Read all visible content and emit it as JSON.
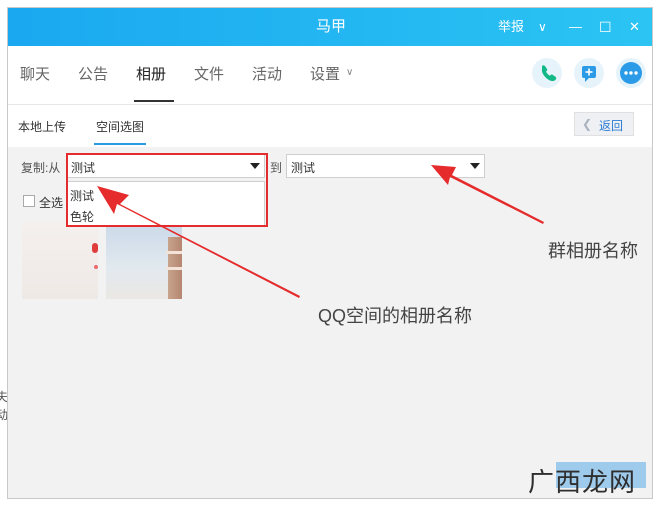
{
  "window": {
    "title": "马甲",
    "report_label": "举报",
    "chevron_glyph": "∨",
    "minimize_glyph": "—",
    "maximize_glyph": "☐",
    "close_glyph": "✕"
  },
  "tabs": [
    {
      "label": "聊天"
    },
    {
      "label": "公告"
    },
    {
      "label": "相册"
    },
    {
      "label": "文件"
    },
    {
      "label": "活动"
    },
    {
      "label": "设置"
    }
  ],
  "settings_chevron": "∨",
  "subtabs": {
    "local_upload": "本地上传",
    "space_select": "空间选图"
  },
  "back_button": {
    "label": "返回",
    "glyph": "❮"
  },
  "copy_row": {
    "from_label": "复制:从",
    "from_value": "测试",
    "to_label": "到",
    "to_value": "测试"
  },
  "dropdown_options": [
    "测试",
    "色轮"
  ],
  "select_all_label": "全选",
  "annotations": {
    "qq_space_album": "QQ空间的相册名称",
    "group_album": "群相册名称"
  },
  "watermark": "广西龙网",
  "colors": {
    "titlebar_start": "#1aa8f0",
    "titlebar_end": "#2bc4f3",
    "annotation_red": "#e52b2b",
    "phone_green": "#12b886",
    "accent_blue": "#2b9be8"
  },
  "icons": {
    "phone": "phone-icon",
    "add_message": "add-message-icon",
    "more": "more-icon"
  }
}
